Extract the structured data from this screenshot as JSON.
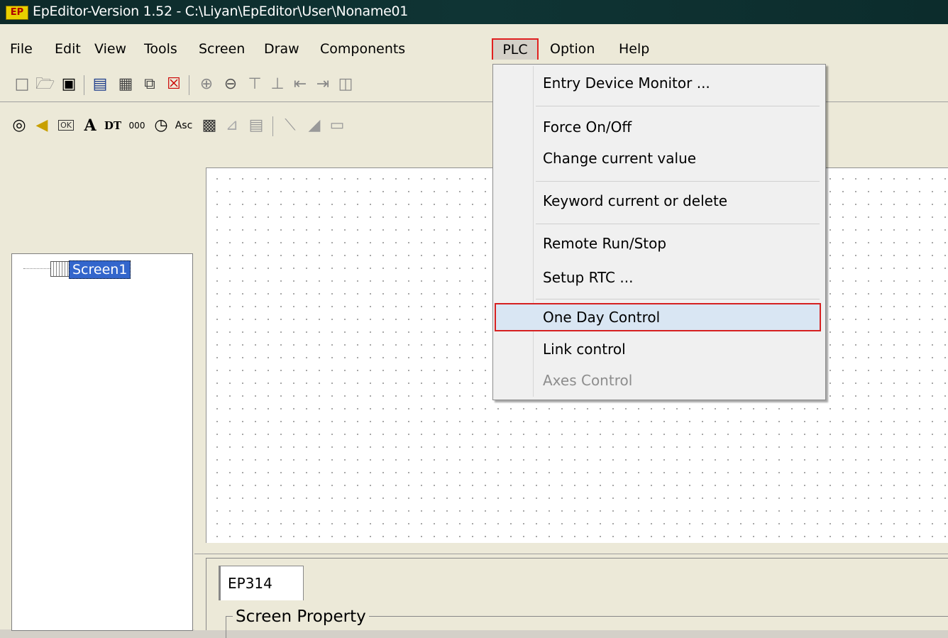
{
  "window": {
    "title": "EpEditor-Version 1.52 - C:\\Liyan\\EpEditor\\User\\Noname01",
    "logo_text": "EP"
  },
  "menubar": {
    "items": [
      "File",
      "Edit",
      "View",
      "Tools",
      "Screen",
      "Draw",
      "Components",
      "PLC",
      "Option",
      "Help"
    ],
    "active": "PLC"
  },
  "toolbar1": {
    "icons": [
      "new-file-icon",
      "open-folder-icon",
      "save-icon",
      "new-screen-icon",
      "screen-grid-icon",
      "copy-screen-icon",
      "delete-screen-icon",
      "zoom-in-icon",
      "zoom-out-icon",
      "align-top-icon",
      "align-bottom-icon",
      "align-left-icon",
      "align-right-icon",
      "align-center-icon"
    ]
  },
  "toolbar2": {
    "icons": [
      "lamp-icon",
      "buzzer-icon",
      "ok-button-icon",
      "text-icon",
      "dynamic-text-icon",
      "numeric-icon",
      "clock-icon",
      "ascii-icon",
      "bitmap-icon",
      "trend-graph-icon",
      "bar-graph-icon",
      "line-tool-icon",
      "arc-tool-icon",
      "rectangle-tool-icon"
    ],
    "labels": {
      "text": "A",
      "dynamic_text": "DT",
      "numeric": "000",
      "ascii": "Asc",
      "ok": "OK"
    }
  },
  "tree": {
    "node_label": "Screen1"
  },
  "property": {
    "tab_label": "EP314",
    "group_label": "Screen Property"
  },
  "plc_menu": {
    "items": [
      {
        "label": "Entry Device Monitor ...",
        "enabled": true
      },
      {
        "label": "Force On/Off",
        "enabled": true
      },
      {
        "label": "Change current value",
        "enabled": true
      },
      {
        "label": "Keyword current or delete",
        "enabled": true
      },
      {
        "label": "Remote Run/Stop",
        "enabled": true
      },
      {
        "label": "Setup RTC ...",
        "enabled": true
      },
      {
        "label": "One Day Control",
        "enabled": true,
        "highlighted": true
      },
      {
        "label": "Link control",
        "enabled": true
      },
      {
        "label": "Axes Control",
        "enabled": false
      }
    ]
  },
  "colors": {
    "highlight_border": "#e02020",
    "selection": "#3366cc",
    "titlebar": "#0f3434"
  }
}
